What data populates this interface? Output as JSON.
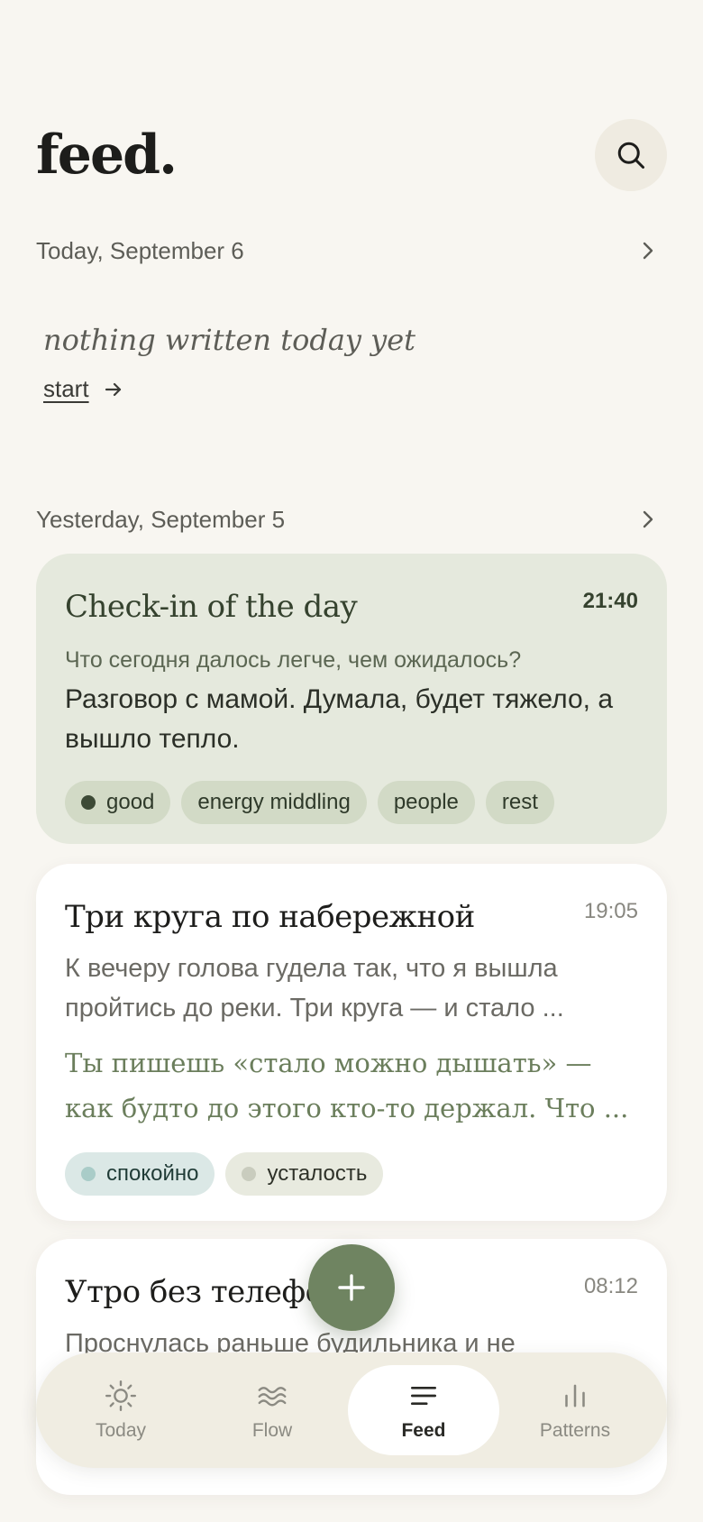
{
  "header": {
    "title": "feed."
  },
  "today": {
    "label": "Today, September 6",
    "empty_text": "nothing written today yet",
    "start_label": "start"
  },
  "yesterday": {
    "label": "Yesterday, September 5"
  },
  "entries": [
    {
      "title": "Check-in of the day",
      "time": "21:40",
      "question": "Что сегодня далось легче, чем ожидалось?",
      "answer": "Разговор с мамой. Думала, будет тяжело, а вышло тепло.",
      "tags": [
        "good",
        "energy middling",
        "people",
        "rest"
      ]
    },
    {
      "title": "Три круга по набережной",
      "time": "19:05",
      "preview": "К вечеру голова гудела так, что я вышла пройтись до реки. Три круга — и стало ...",
      "reflection": "Ты пишешь «стало можно дышать» — как будто до этого кто-то держал. Что ...",
      "tags": [
        "спокойно",
        "усталость"
      ]
    },
    {
      "title": "Утро без телефона",
      "time": "08:12",
      "preview": "Проснулась раньше будильника и не"
    }
  ],
  "tabs": [
    {
      "label": "Today",
      "icon": "sun-icon"
    },
    {
      "label": "Flow",
      "icon": "waves-icon"
    },
    {
      "label": "Feed",
      "icon": "list-icon",
      "active": true
    },
    {
      "label": "Patterns",
      "icon": "bar-chart-icon"
    }
  ],
  "colors": {
    "accent": "#6f8461",
    "checkin_bg": "#e5e9dd",
    "mood_good_dot": "#3d4a36",
    "calm_dot": "#a9ccc8",
    "tired_dot": "#c9ccbe"
  }
}
